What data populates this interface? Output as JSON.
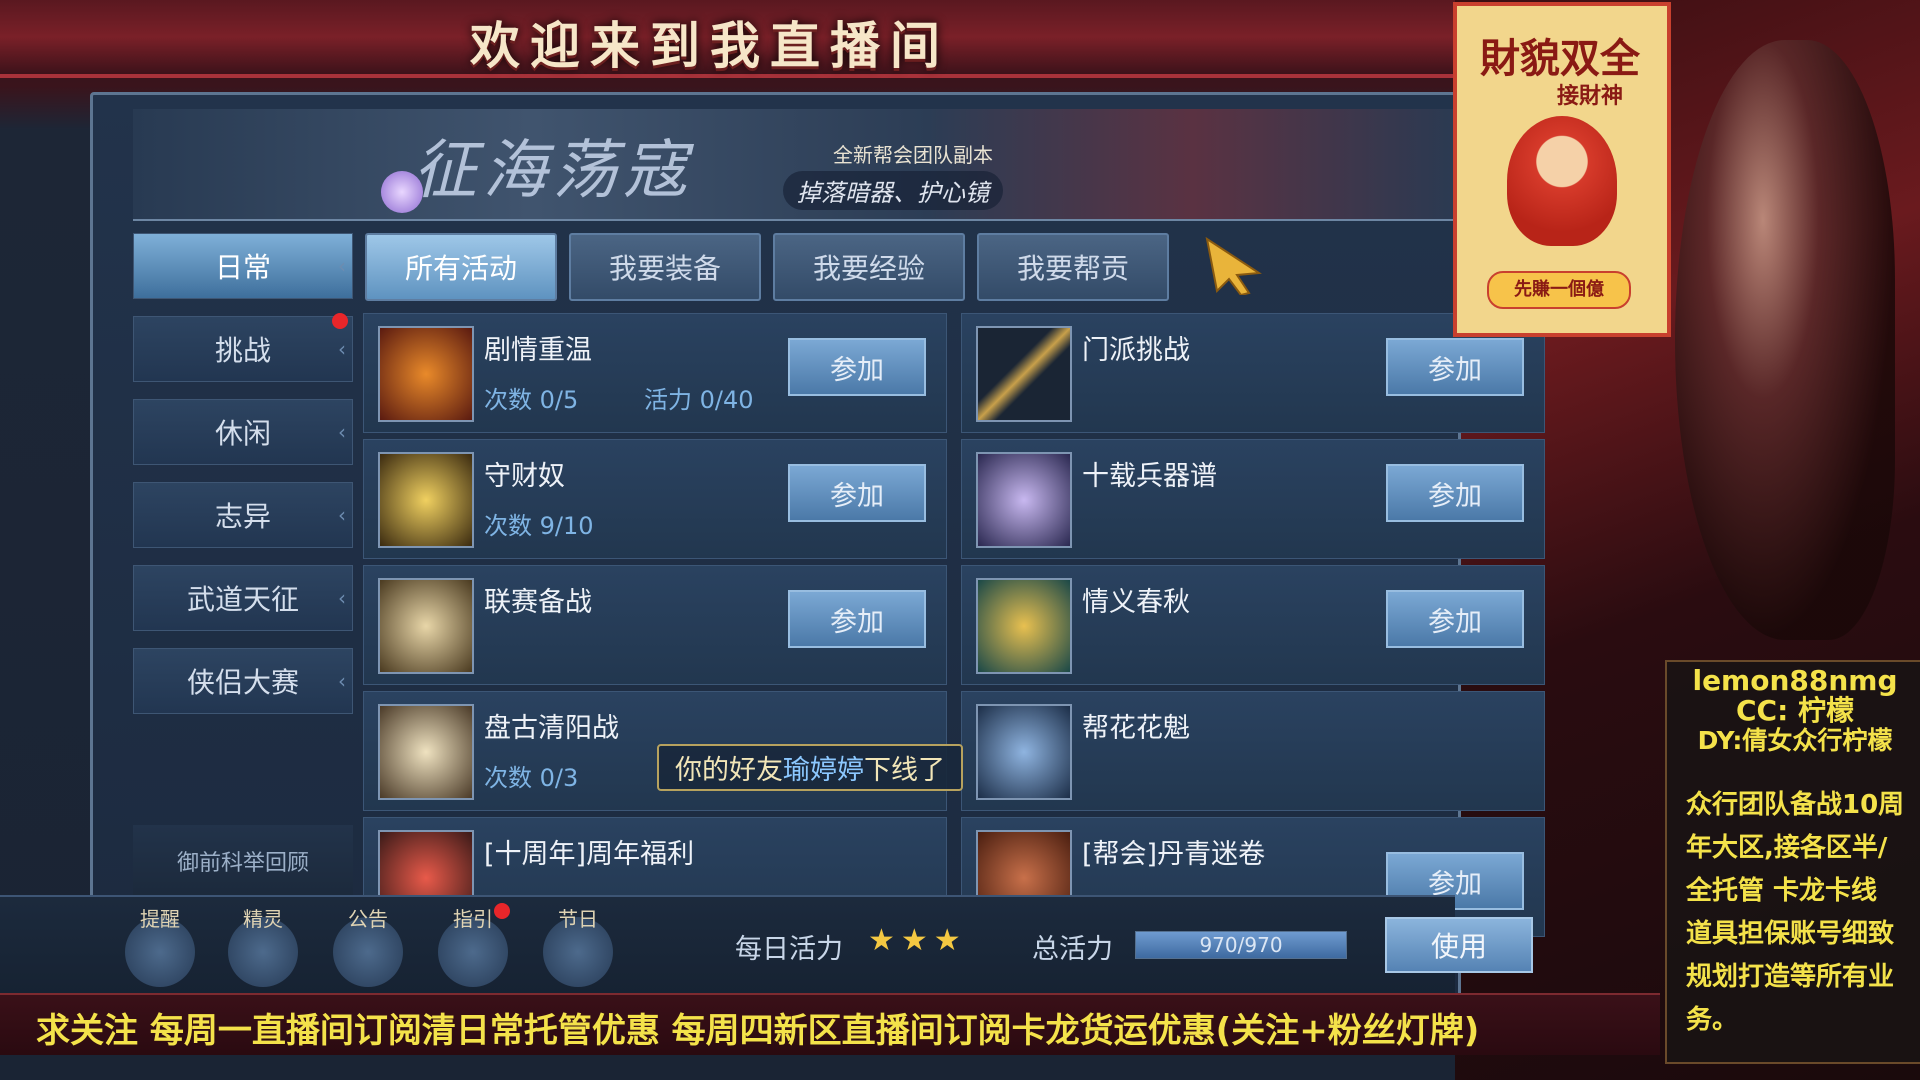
{
  "stream_title": "欢迎来到我直播间",
  "event_banner": {
    "title": "征海荡寇",
    "subtitle1": "全新帮会团队副本",
    "subtitle2": "掉落暗器、护心镜"
  },
  "sidebar": {
    "items": [
      {
        "label": "日常",
        "active": true
      },
      {
        "label": "挑战",
        "badge": true
      },
      {
        "label": "休闲"
      },
      {
        "label": "志异"
      },
      {
        "label": "武道天征"
      },
      {
        "label": "侠侣大赛"
      }
    ],
    "extra": "御前科举回顾"
  },
  "tabs": [
    {
      "label": "所有活动",
      "active": true
    },
    {
      "label": "我要装备"
    },
    {
      "label": "我要经验"
    },
    {
      "label": "我要帮贡"
    }
  ],
  "activities": [
    {
      "name": "剧情重温",
      "count": "次数 0/5",
      "vigor": "活力 0/40",
      "button": "参加",
      "icon": "helmet-icon"
    },
    {
      "name": "门派挑战",
      "button": "参加",
      "icon": "spear-icon"
    },
    {
      "name": "守财奴",
      "count": "次数 9/10",
      "button": "参加",
      "icon": "gold-leaf-icon"
    },
    {
      "name": "十载兵器谱",
      "button": "参加",
      "icon": "weapon-rack-icon"
    },
    {
      "name": "联赛备战",
      "button": "参加",
      "icon": "scroll-icon"
    },
    {
      "name": "情义春秋",
      "button": "参加",
      "icon": "qingyi-emblem-icon"
    },
    {
      "name": "盘古清阳战",
      "count": "次数 0/3",
      "icon": "letter-icon"
    },
    {
      "name": "帮花花魁",
      "icon": "pouch-icon"
    },
    {
      "name": "[十周年]周年福利",
      "icon": "gift-icon"
    },
    {
      "name": "[帮会]丹青迷卷",
      "button": "参加",
      "icon": "bang-coin-icon"
    }
  ],
  "toast": {
    "prefix": "你的好友",
    "friend": "瑜婷婷",
    "suffix": "下线了"
  },
  "bottom_bar": {
    "icons": [
      {
        "label": "提醒",
        "icon": "book-icon"
      },
      {
        "label": "精灵",
        "icon": "spirit-icon"
      },
      {
        "label": "公告",
        "icon": "horn-icon"
      },
      {
        "label": "指引",
        "icon": "guide-icon",
        "badge": true
      },
      {
        "label": "节日",
        "icon": "festival-icon"
      }
    ],
    "daily_vigor_label": "每日活力",
    "stars": "★★★",
    "total_vigor_label": "总活力",
    "total_vigor_value": "970/970",
    "total_vigor_fraction": 1.0,
    "use_button": "使用"
  },
  "ticker": "求关注 每周一直播间订阅清日常托管优惠 每周四新区直播间订阅卡龙货运优惠(关注+粉丝灯牌)",
  "poster": {
    "title": "財貌双全",
    "subtitle": "接財神",
    "footer": "先賺一個億"
  },
  "streamer": {
    "name": "lemon88nmg",
    "cc": "CC: 柠檬",
    "dy": "DY:倩女众行柠檬"
  },
  "description": "众行团队备战10周年大区,接各区半/全托管 卡龙卡线 道具担保账号细致规划打造等所有业务。",
  "colors": {
    "ticker_text": "#f4e24a",
    "accent_blue": "#7fb4e4",
    "badge_red": "#e8262a"
  }
}
